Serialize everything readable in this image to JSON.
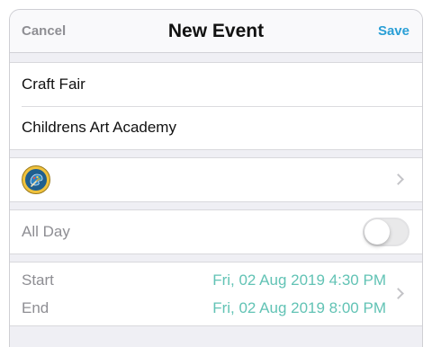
{
  "nav": {
    "cancel_label": "Cancel",
    "title": "New Event",
    "save_label": "Save"
  },
  "details": {
    "title_value": "Craft Fair",
    "location_value": "Childrens Art Academy"
  },
  "category": {
    "icon": "artist-palette-icon"
  },
  "all_day": {
    "label": "All Day",
    "enabled": false
  },
  "schedule": {
    "start_label": "Start",
    "start_value": "Fri, 02 Aug 2019 4:30 PM",
    "end_label": "End",
    "end_value": "Fri, 02 Aug 2019 8:00 PM"
  },
  "colors": {
    "accent": "#2a9fd6",
    "date": "#62c3b5",
    "muted": "#8e8e93"
  }
}
